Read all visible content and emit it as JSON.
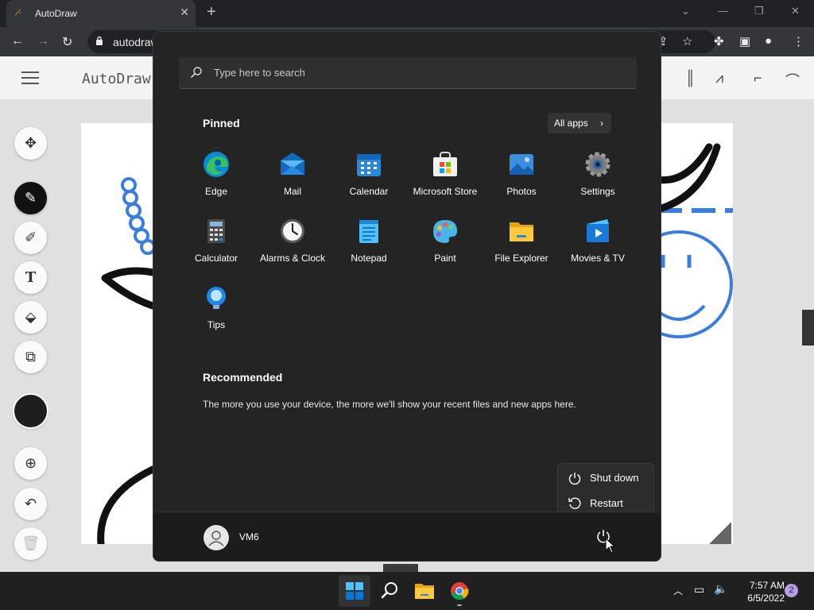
{
  "browser": {
    "tab_title": "AutoDraw",
    "tab_favicon": "autodraw-favicon",
    "url": "autodraw.com"
  },
  "autodraw": {
    "brand": "AutoDraw"
  },
  "start_menu": {
    "search_placeholder": "Type here to search",
    "pinned_title": "Pinned",
    "all_apps_label": "All apps",
    "pinned_apps": [
      {
        "label": "Edge",
        "icon": "edge-icon"
      },
      {
        "label": "Mail",
        "icon": "mail-icon"
      },
      {
        "label": "Calendar",
        "icon": "calendar-icon"
      },
      {
        "label": "Microsoft Store",
        "icon": "store-icon"
      },
      {
        "label": "Photos",
        "icon": "photos-icon"
      },
      {
        "label": "Settings",
        "icon": "settings-icon"
      },
      {
        "label": "Calculator",
        "icon": "calculator-icon"
      },
      {
        "label": "Alarms & Clock",
        "icon": "clock-icon"
      },
      {
        "label": "Notepad",
        "icon": "notepad-icon"
      },
      {
        "label": "Paint",
        "icon": "paint-icon"
      },
      {
        "label": "File Explorer",
        "icon": "folder-icon"
      },
      {
        "label": "Movies & TV",
        "icon": "movies-icon"
      },
      {
        "label": "Tips",
        "icon": "tips-icon"
      }
    ],
    "recommended_title": "Recommended",
    "recommended_text": "The more you use your device, the more we'll show your recent files and new apps here.",
    "user_name": "VM6",
    "power_menu": {
      "shutdown_label": "Shut down",
      "restart_label": "Restart"
    }
  },
  "taskbar": {
    "time": "7:57 AM",
    "date": "6/5/2022",
    "notification_count": "2"
  },
  "colors": {
    "start_bg": "#242424",
    "taskbar_bg": "#202020",
    "windows_blue": "#0078d4",
    "autodraw_doodle_blue": "#3b7ddd"
  }
}
